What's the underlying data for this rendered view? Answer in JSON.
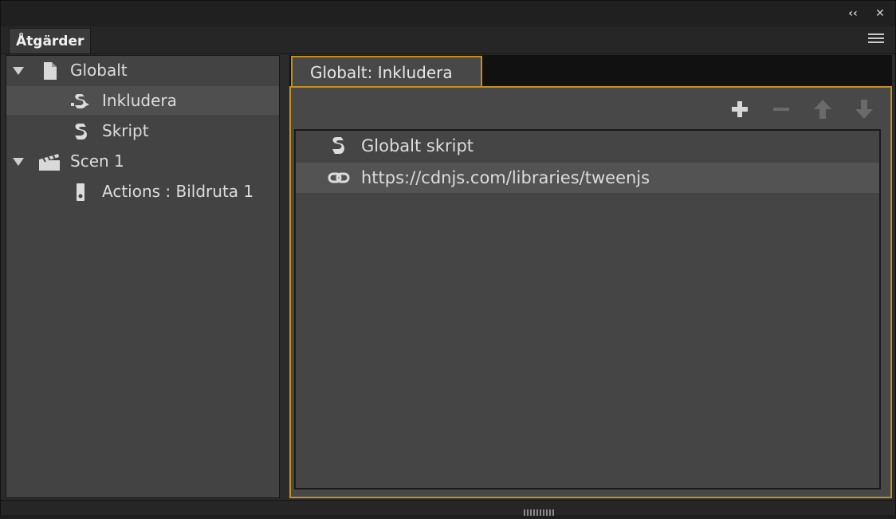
{
  "window": {
    "collapse_glyph": "‹‹",
    "close_glyph": "✕"
  },
  "panel": {
    "title": "Åtgärder"
  },
  "tree": {
    "items": [
      {
        "label": "Globalt",
        "icon": "document-icon",
        "expanded": true,
        "level": 0
      },
      {
        "label": "Inkludera",
        "icon": "include-script-icon",
        "level": 1,
        "selected": true
      },
      {
        "label": "Skript",
        "icon": "script-icon",
        "level": 1
      },
      {
        "label": "Scen 1",
        "icon": "clapperboard-icon",
        "expanded": true,
        "level": 0
      },
      {
        "label": "Actions : Bildruta 1",
        "icon": "frame-icon",
        "level": 1
      }
    ]
  },
  "editor": {
    "tab_label": "Globalt: Inkludera",
    "toolbar": {
      "add": "add-icon",
      "remove": "remove-icon",
      "move_up": "arrow-up-icon",
      "move_down": "arrow-down-icon"
    },
    "rows": [
      {
        "label": "Globalt skript",
        "icon": "script-icon"
      },
      {
        "label": "https://cdnjs.com/libraries/tweenjs",
        "icon": "link-icon"
      }
    ]
  },
  "colors": {
    "accent": "#c2901c",
    "panel_bg": "#434343",
    "selected_row": "#4f4f4f"
  }
}
